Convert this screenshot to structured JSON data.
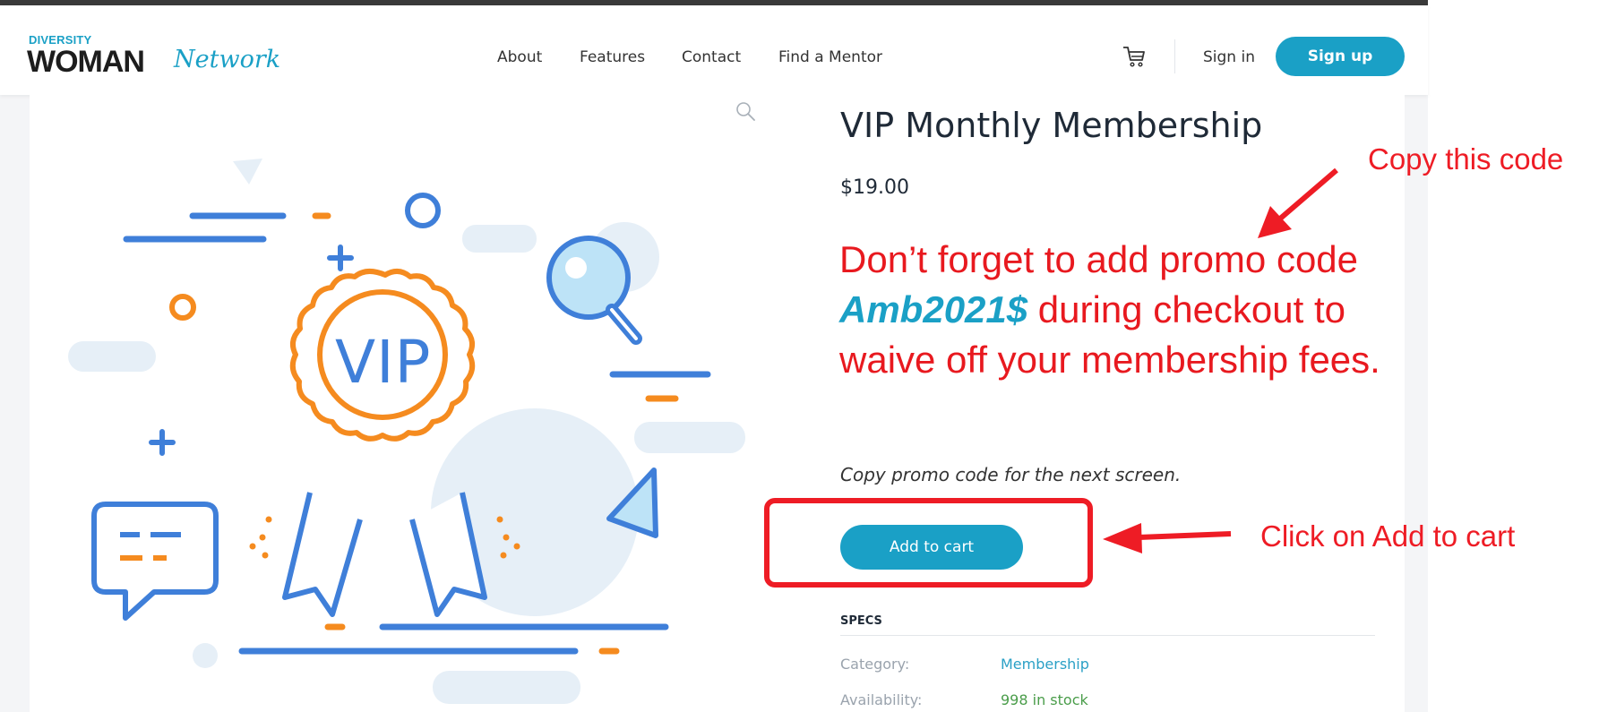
{
  "brand": {
    "logo_small": "DIVERSITY",
    "logo_main": "WOMAN",
    "logo_script": "Network",
    "accent_color": "#1aa0c6",
    "annotation_color": "#ee1c25"
  },
  "nav": {
    "items": [
      {
        "label": "About"
      },
      {
        "label": "Features"
      },
      {
        "label": "Contact"
      },
      {
        "label": "Find a Mentor"
      }
    ],
    "cart_icon": "cart-icon",
    "signin_label": "Sign in",
    "signup_label": "Sign up"
  },
  "product": {
    "title": "VIP Monthly Membership",
    "price": "$19.00",
    "promo_before": "Don’t forget to add promo code ",
    "promo_code": "Amb2021$",
    "promo_after": " during checkout to waive off your membership fees.",
    "copy_note": "Copy promo code for the next screen.",
    "add_to_cart_label": "Add to cart",
    "image_badge_text": "VIP",
    "zoom_icon": "magnifier-icon"
  },
  "specs": {
    "heading": "SPECS",
    "rows": [
      {
        "key": "Category:",
        "value": "Membership"
      },
      {
        "key": "Availability:",
        "value": "998 in stock"
      }
    ]
  },
  "annotations": {
    "copy_code": "Copy this code",
    "click_cart": "Click on Add to cart"
  }
}
